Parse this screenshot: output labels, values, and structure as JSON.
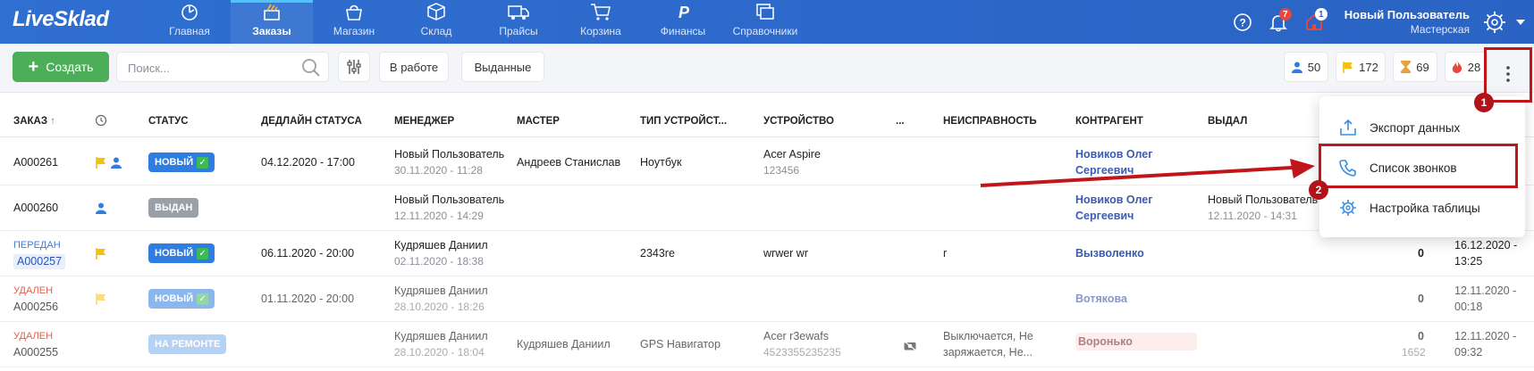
{
  "app": {
    "logo": "LiveSklad"
  },
  "nav": [
    {
      "label": "Главная",
      "icon": "dashboard-icon"
    },
    {
      "label": "Заказы",
      "icon": "orders-icon",
      "active": true
    },
    {
      "label": "Магазин",
      "icon": "shop-icon"
    },
    {
      "label": "Склад",
      "icon": "warehouse-icon"
    },
    {
      "label": "Прайсы",
      "icon": "truck-icon"
    },
    {
      "label": "Корзина",
      "icon": "cart-icon"
    },
    {
      "label": "Финансы",
      "icon": "ruble-icon"
    },
    {
      "label": "Справочники",
      "icon": "catalog-icon"
    }
  ],
  "header": {
    "notifications_count": "7",
    "home_count": "1",
    "user_name": "Новый Пользователь",
    "user_org": "Мастерская"
  },
  "toolbar": {
    "create_label": "Создать",
    "search_placeholder": "Поиск...",
    "chip_in_work": "В работе",
    "chip_issued": "Выданные",
    "counters": [
      {
        "icon": "person-icon",
        "value": "50",
        "color": "#2f7de1"
      },
      {
        "icon": "flag-icon",
        "value": "172",
        "color": "#f4c20d"
      },
      {
        "icon": "hourglass-icon",
        "value": "69",
        "color": "#e6a23c"
      },
      {
        "icon": "fire-icon",
        "value": "28",
        "color": "#e8483c"
      }
    ]
  },
  "table": {
    "headers": {
      "order": "ЗАКАЗ",
      "status": "СТАТУС",
      "deadline": "ДЕДЛАЙН СТАТУСА",
      "manager": "МЕНЕДЖЕР",
      "master": "МАСТЕР",
      "device_type": "ТИП УСТРОЙСТ...",
      "device": "УСТРОЙСТВО",
      "dots": "...",
      "fault": "НЕИСПРАВНОСТЬ",
      "contractor": "КОНТРАГЕНТ",
      "issued_by": "ВЫДАЛ"
    },
    "rows": [
      {
        "prefix": "",
        "id": "A000261",
        "status": "НОВЫЙ",
        "deadline": "04.12.2020 - 17:00",
        "manager": "Новый Пользователь",
        "manager_date": "30.11.2020 - 11:28",
        "master": "Андреев Станислав",
        "device_type": "Ноутбук",
        "device": "Acer Aspire",
        "device_sn": "123456",
        "fault": "",
        "fault2": "",
        "contractor": "Новиков Олег",
        "contractor2": "Сергеевич",
        "issued": "",
        "issued_date": "",
        "num": "",
        "num_sub": "",
        "date_right": "",
        "date_right2": ""
      },
      {
        "prefix": "",
        "id": "A000260",
        "status": "ВЫДАН",
        "deadline": "",
        "manager": "Новый Пользователь",
        "manager_date": "12.11.2020 - 14:29",
        "master": "",
        "device_type": "",
        "device": "",
        "device_sn": "",
        "fault": "",
        "fault2": "",
        "contractor": "Новиков Олег",
        "contractor2": "Сергеевич",
        "issued": "Новый Пользователь",
        "issued_date": "12.11.2020 - 14:31",
        "num": "",
        "num_sub": "",
        "date_right": "",
        "date_right2": ""
      },
      {
        "prefix": "ПЕРЕДАН",
        "id": "A000257",
        "status": "НОВЫЙ",
        "deadline": "06.11.2020 - 20:00",
        "manager": "Кудряшев Даниил",
        "manager_date": "02.11.2020 - 18:38",
        "master": "",
        "device_type": "2343re",
        "device": "wrwer wr",
        "device_sn": "",
        "fault": "r",
        "fault2": "",
        "contractor": "Вызволенко",
        "contractor2": "",
        "issued": "",
        "issued_date": "",
        "num": "0",
        "num_sub": "",
        "date_right": "16.12.2020 -",
        "date_right2": "13:25"
      },
      {
        "prefix": "УДАЛЕН",
        "id": "A000256",
        "status": "НОВЫЙ",
        "deadline": "01.11.2020 - 20:00",
        "manager": "Кудряшев Даниил",
        "manager_date": "28.10.2020 - 18:26",
        "master": "",
        "device_type": "",
        "device": "",
        "device_sn": "",
        "fault": "",
        "fault2": "",
        "contractor": "Вотякова",
        "contractor2": "",
        "issued": "",
        "issued_date": "",
        "num": "0",
        "num_sub": "",
        "date_right": "12.11.2020 -",
        "date_right2": "00:18"
      },
      {
        "prefix": "УДАЛЕН",
        "id": "A000255",
        "status": "НА РЕМОНТЕ",
        "deadline": "",
        "manager": "Кудряшев Даниил",
        "manager_date": "28.10.2020 - 18:04",
        "master": "Кудряшев Даниил",
        "device_type": "GPS Навигатор",
        "device": "Acer r3ewafs",
        "device_sn": "4523355235235",
        "fault": "Выключается, Не",
        "fault2": "заряжается, Не...",
        "contractor": "Воронько",
        "contractor2": "",
        "issued": "",
        "issued_date": "",
        "num": "0",
        "num_sub": "1652",
        "date_right": "12.11.2020 -",
        "date_right2": "09:32"
      }
    ]
  },
  "dropdown": {
    "export": "Экспорт данных",
    "calls": "Список звонков",
    "table_settings": "Настройка таблицы"
  },
  "annotations": {
    "marker1": "1",
    "marker2": "2"
  }
}
